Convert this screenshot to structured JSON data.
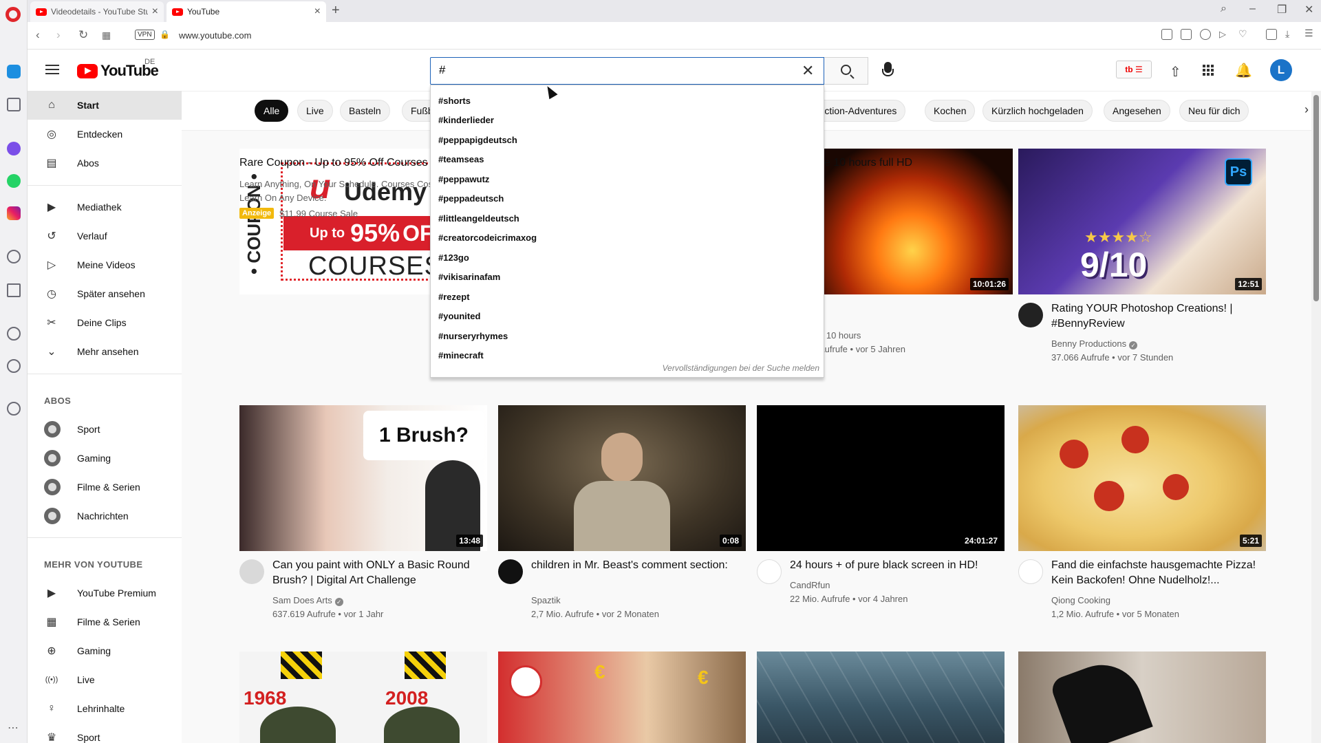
{
  "browser": {
    "tabs": [
      {
        "title": "Videodetails - YouTube Stu",
        "active": false
      },
      {
        "title": "YouTube",
        "active": true
      }
    ],
    "new_tab": "+",
    "url": "www.youtube.com",
    "vpn": "VPN"
  },
  "youtube": {
    "logo_text": "YouTube",
    "country_code": "DE",
    "search": {
      "value": "#",
      "clear": "✕"
    },
    "avatar_letter": "L",
    "ext_badge": "tb ☰",
    "suggestions": [
      "#shorts",
      "#kinderlieder",
      "#peppapigdeutsch",
      "#teamseas",
      "#peppawutz",
      "#peppadeutsch",
      "#littleangeldeutsch",
      "#creatorcodeicrimaxog",
      "#123go",
      "#vikisarinafam",
      "#rezept",
      "#younited",
      "#nurseryrhymes",
      "#minecraft"
    ],
    "suggestions_report": "Vervollständigungen bei der Suche melden",
    "guide": {
      "main": [
        {
          "label": "Start",
          "icon": "home-icon",
          "glyph": "⌂",
          "active": true
        },
        {
          "label": "Entdecken",
          "icon": "compass-icon",
          "glyph": "◎",
          "active": false
        },
        {
          "label": "Abos",
          "icon": "subscriptions-icon",
          "glyph": "▤",
          "active": false
        }
      ],
      "library": [
        {
          "label": "Mediathek",
          "icon": "library-icon",
          "glyph": "▶"
        },
        {
          "label": "Verlauf",
          "icon": "history-icon",
          "glyph": "↺"
        },
        {
          "label": "Meine Videos",
          "icon": "my-videos-icon",
          "glyph": "▷"
        },
        {
          "label": "Später ansehen",
          "icon": "watch-later-icon",
          "glyph": "◷"
        },
        {
          "label": "Deine Clips",
          "icon": "scissors-icon",
          "glyph": "✂"
        },
        {
          "label": "Mehr ansehen",
          "icon": "chevron-down-icon",
          "glyph": "⌄"
        }
      ],
      "abos_heading": "ABOS",
      "abos": [
        {
          "label": "Sport",
          "icon": "sport-channel-icon"
        },
        {
          "label": "Gaming",
          "icon": "gaming-channel-icon"
        },
        {
          "label": "Filme & Serien",
          "icon": "movies-channel-icon"
        },
        {
          "label": "Nachrichten",
          "icon": "news-channel-icon"
        }
      ],
      "more_heading": "MEHR VON YOUTUBE",
      "more": [
        {
          "label": "YouTube Premium",
          "icon": "youtube-premium-icon",
          "glyph": "▶"
        },
        {
          "label": "Filme & Serien",
          "icon": "film-icon",
          "glyph": "▦"
        },
        {
          "label": "Gaming",
          "icon": "gamepad-icon",
          "glyph": "⊕"
        },
        {
          "label": "Live",
          "icon": "live-icon",
          "glyph": "((•))"
        },
        {
          "label": "Lehrinhalte",
          "icon": "lightbulb-icon",
          "glyph": "♀"
        },
        {
          "label": "Sport",
          "icon": "trophy-icon",
          "glyph": "♛"
        }
      ]
    },
    "chips": [
      {
        "label": "Alle",
        "active": true
      },
      {
        "label": "Live"
      },
      {
        "label": "Basteln"
      },
      {
        "label": "Fußb"
      },
      {
        "label": "Action-Adventures"
      },
      {
        "label": "Kochen"
      },
      {
        "label": "Kürzlich hochgeladen"
      },
      {
        "label": "Angesehen"
      },
      {
        "label": "Neu für dich"
      }
    ],
    "colors": {
      "brand_red": "#ff0000",
      "search_focus": "#1c62b9",
      "ad_badge": "#f2b90d"
    },
    "videos": [
      {
        "title": "Rare Coupon - Up to 95% Off Courses",
        "channel": "Learn Anything, On Your Schedule. Courses Cost",
        "meta": "Learn On Any Device.",
        "ad_label": "Anzeige",
        "ad_price": "$11.99 Course Sale",
        "thumb_text": {
          "coupon": "• COUPON •",
          "brand": "Udemy",
          "upto": "Up to",
          "pct": "95%",
          "off": "OFF",
          "courses": "COURSES"
        }
      },
      {
        "title": "ce 10 hours full HD",
        "channel": "e 10 hours",
        "meta": "Aufrufe • vor 5 Jahren",
        "duration": "10:01:26"
      },
      {
        "title": "Rating YOUR Photoshop Creations! | #BennyReview",
        "channel": "Benny Productions",
        "meta": "37.066 Aufrufe • vor 7 Stunden",
        "duration": "12:51",
        "thumb_text": {
          "ps": "Ps",
          "score": "9/10"
        }
      },
      {
        "title": "Can you paint with ONLY a Basic Round Brush? | Digital Art Challenge",
        "channel": "Sam Does Arts",
        "meta": "637.619 Aufrufe • vor 1 Jahr",
        "duration": "13:48",
        "thumb_text": {
          "brush": "1 Brush?"
        }
      },
      {
        "title": "children in Mr. Beast's comment section:",
        "channel": "Spaztik",
        "meta": "2,7 Mio. Aufrufe • vor 2 Monaten",
        "duration": "0:08"
      },
      {
        "title": "24 hours + of pure black screen in HD!",
        "channel": "CandRfun",
        "meta": "22 Mio. Aufrufe • vor 4 Jahren",
        "duration": "24:01:27"
      },
      {
        "title": "Fand die einfachste hausgemachte Pizza! Kein Backofen! Ohne Nudelholz!...",
        "channel": "Qiong Cooking",
        "meta": "1,2 Mio. Aufrufe • vor 5 Monaten",
        "duration": "5:21"
      }
    ],
    "row3_thumb_text": {
      "y1": "1968",
      "y2": "2008",
      "euro": "€"
    }
  }
}
